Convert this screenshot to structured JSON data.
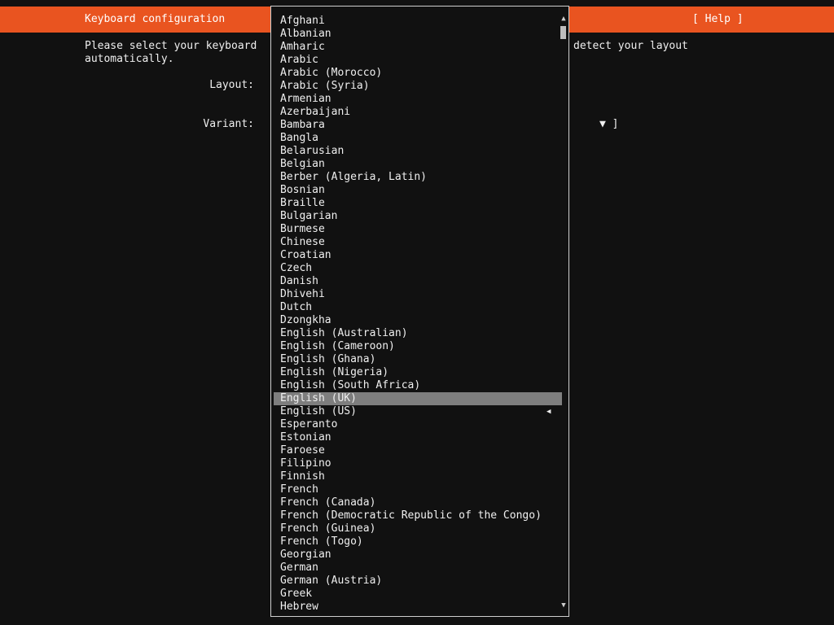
{
  "header": {
    "title": "Keyboard configuration",
    "help_label": "[ Help ]"
  },
  "intro": {
    "line1_left": "Please select your keyboard",
    "line1_right": "detect your layout",
    "line2": "automatically."
  },
  "form": {
    "layout_label": "Layout:",
    "variant_label": "Variant:",
    "variant_arrow": "▼ ]"
  },
  "dropdown": {
    "scroll_up": "▲",
    "scroll_down": "▼",
    "current_marker": "◀",
    "selected_index": 29,
    "current_index": 30,
    "items": [
      "Afghani",
      "Albanian",
      "Amharic",
      "Arabic",
      "Arabic (Morocco)",
      "Arabic (Syria)",
      "Armenian",
      "Azerbaijani",
      "Bambara",
      "Bangla",
      "Belarusian",
      "Belgian",
      "Berber (Algeria, Latin)",
      "Bosnian",
      "Braille",
      "Bulgarian",
      "Burmese",
      "Chinese",
      "Croatian",
      "Czech",
      "Danish",
      "Dhivehi",
      "Dutch",
      "Dzongkha",
      "English (Australian)",
      "English (Cameroon)",
      "English (Ghana)",
      "English (Nigeria)",
      "English (South Africa)",
      "English (UK)",
      "English (US)",
      "Esperanto",
      "Estonian",
      "Faroese",
      "Filipino",
      "Finnish",
      "French",
      "French (Canada)",
      "French (Democratic Republic of the Congo)",
      "French (Guinea)",
      "French (Togo)",
      "Georgian",
      "German",
      "German (Austria)",
      "Greek",
      "Hebrew"
    ]
  }
}
